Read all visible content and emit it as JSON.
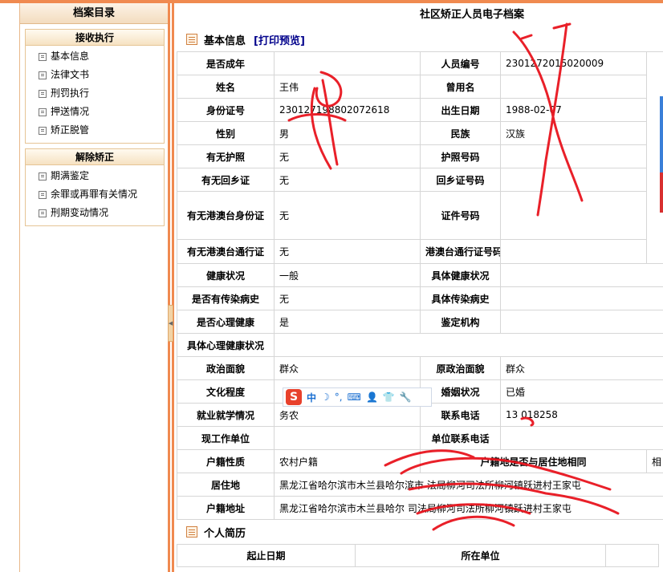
{
  "sidebar": {
    "title": "档案目录",
    "groups": [
      {
        "label": "接收执行",
        "items": [
          "基本信息",
          "法律文书",
          "刑罚执行",
          "押送情况",
          "矫正脱管"
        ]
      },
      {
        "label": "解除矫正",
        "items": [
          "期满鉴定",
          "余罪或再罪有关情况",
          "刑期变动情况"
        ]
      }
    ]
  },
  "main": {
    "title": "社区矫正人员电子档案",
    "basic_section": {
      "title": "基本信息",
      "print_link": "[打印预览]"
    },
    "resume_section": {
      "title": "个人简历",
      "col1": "起止日期",
      "col2": "所在单位"
    }
  },
  "fields": {
    "adult_label": "是否成年",
    "adult_value": "",
    "person_no_label": "人员编号",
    "person_no_value": "2301272015020009",
    "name_label": "姓名",
    "name_value": "王伟",
    "alias_label": "曾用名",
    "alias_value": "",
    "id_label": "身份证号",
    "id_value": "230127198802072618",
    "birth_label": "出生日期",
    "birth_value": "1988-02-07",
    "gender_label": "性别",
    "gender_value": "男",
    "ethnic_label": "民族",
    "ethnic_value": "汉族",
    "passport_label": "有无护照",
    "passport_value": "无",
    "passport_no_label": "护照号码",
    "passport_no_value": "",
    "hometown_label": "有无回乡证",
    "hometown_value": "无",
    "hometown_no_label": "回乡证号码",
    "hometown_no_value": "",
    "hkmt_id_label": "有无港澳台身份证",
    "hkmt_id_value": "无",
    "cert_no_label": "证件号码",
    "cert_no_value": "",
    "hkmt_pass_label": "有无港澳台通行证",
    "hkmt_pass_value": "无",
    "hkmt_pass_no_label": "港澳台通行证号码",
    "hkmt_pass_no_value": "",
    "health_label": "健康状况",
    "health_value": "一般",
    "health_detail_label": "具体健康状况",
    "health_detail_value": "",
    "infect_label": "是否有传染病史",
    "infect_value": "无",
    "infect_detail_label": "具体传染病史",
    "infect_detail_value": "",
    "mental_label": "是否心理健康",
    "mental_value": "是",
    "appraisal_label": "鉴定机构",
    "appraisal_value": "",
    "mental_detail_label": "具体心理健康状况",
    "mental_detail_value": "",
    "political_label": "政治面貌",
    "political_value": "群众",
    "orig_political_label": "原政治面貌",
    "orig_political_value": "群众",
    "education_label": "文化程度",
    "education_value": "",
    "marital_label": "婚姻状况",
    "marital_value": "已婚",
    "employment_label": "就业就学情况",
    "employment_value": "务农",
    "phone_label": "联系电话",
    "phone_value": "13  018258",
    "work_unit_label": "现工作单位",
    "work_unit_value": "",
    "unit_phone_label": "单位联系电话",
    "unit_phone_value": "",
    "hukou_type_label": "户籍性质",
    "hukou_type_value": "农村户籍",
    "hukou_same_label": "户籍地是否与居住地相同",
    "hukou_same_value": "相",
    "residence_label": "居住地",
    "residence_value": "黑龙江省哈尔滨市木兰县哈尔滨市     法局柳河司法所柳河镇跃进村王家屯",
    "hukou_addr_label": "户籍地址",
    "hukou_addr_value": "黑龙江省哈尔滨市木兰县哈尔         司法局柳河司法所柳河镇跃进村王家屯"
  },
  "ime": {
    "logo": "S",
    "mode": "中"
  }
}
